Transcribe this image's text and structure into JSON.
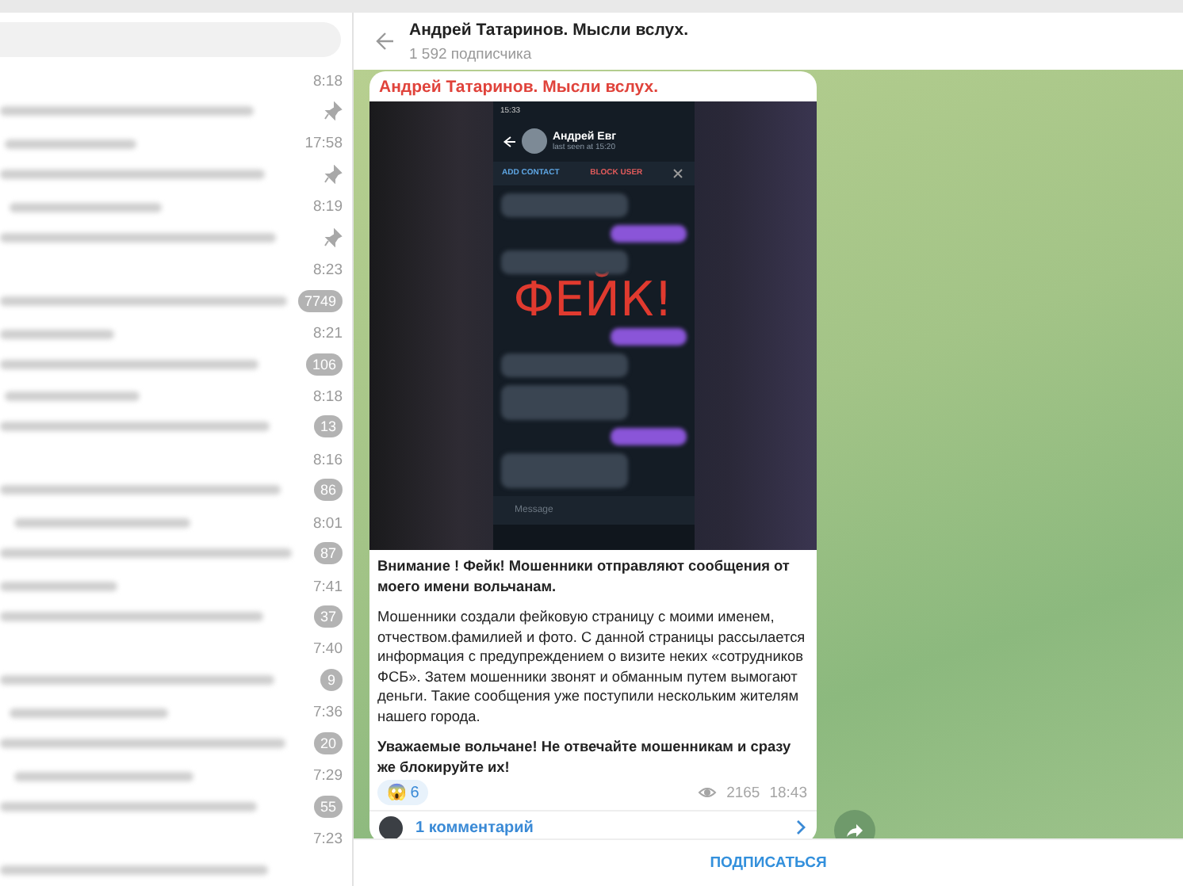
{
  "sidebar": {
    "chats": [
      {
        "time": "8:18",
        "pinned": true
      },
      {
        "time": "17:58",
        "pinned": true
      },
      {
        "time": "8:19",
        "pinned": true
      },
      {
        "time": "8:23",
        "pinned": false,
        "unread": "7749"
      },
      {
        "time": "8:21",
        "pinned": false,
        "unread": "106"
      },
      {
        "time": "8:18",
        "pinned": false,
        "unread": "13"
      },
      {
        "time": "8:16",
        "pinned": false,
        "unread": "86"
      },
      {
        "time": "8:01",
        "pinned": false,
        "unread": "87"
      },
      {
        "time": "7:41",
        "pinned": false,
        "unread": "37"
      },
      {
        "time": "7:40",
        "pinned": false,
        "unread": "9"
      },
      {
        "time": "7:36",
        "pinned": false,
        "unread": "20"
      },
      {
        "time": "7:29",
        "pinned": false,
        "unread": "55"
      },
      {
        "time": "7:23",
        "pinned": false
      }
    ]
  },
  "header": {
    "title": "Андрей Татаринов. Мысли вслух.",
    "subtitle": "1 592 подписчика"
  },
  "message": {
    "sender": "Андрей Татаринов. Мысли вслух.",
    "screenshot": {
      "status_time": "15:33",
      "contact_name": "Андрей Евг",
      "last_seen": "last seen at 15:20",
      "actions": [
        "ADD CONTACT",
        "BLOCK USER"
      ],
      "stamp": "ФЕЙК!",
      "input_placeholder": "Message",
      "bubbles": [
        {
          "kind": "in"
        },
        {
          "kind": "out"
        },
        {
          "kind": "in"
        },
        {
          "kind": "out"
        },
        {
          "kind": "in"
        },
        {
          "kind": "in"
        },
        {
          "kind": "out"
        },
        {
          "kind": "in"
        }
      ]
    },
    "paragraphs": [
      {
        "text": "Внимание ! Фейк! Мошенники отправляют сообщения от моего имени вольчанам.",
        "bold": true
      },
      {
        "text": "Мошенники  создали фейковую страницу с моими именем, отчеством.фамилией и фото. С данной страницы рассылается информация  с предупреждением о визите неких «сотрудников ФСБ». Затем мошенники звонят и обманным путем вымогают деньги. Такие сообщения уже поступили нескольким жителям нашего города.",
        "bold": false
      },
      {
        "text": "Уважаемые вольчане! Не отвечайте мошенникам и сразу же блокируйте их!",
        "bold": true
      }
    ],
    "reaction": {
      "emoji": "😱",
      "count": "6"
    },
    "views": "2165",
    "time": "18:43",
    "comments": "1 комментарий"
  },
  "footer": {
    "button": "ПОДПИСАТЬСЯ"
  }
}
